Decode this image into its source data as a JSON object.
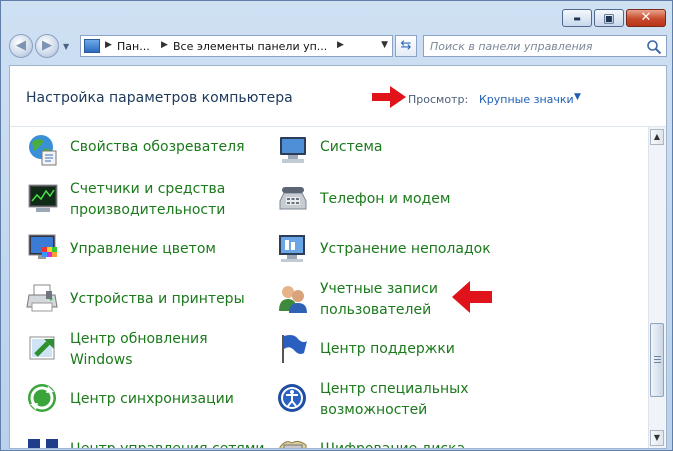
{
  "window": {
    "controls": {
      "minimize": "▬",
      "maximize": "▣",
      "close": "✕"
    }
  },
  "navbar": {
    "back": "◀",
    "forward": "▶",
    "history_drop": "▼",
    "address": {
      "seg1": "Пан...",
      "seg2": "Все элементы панели уп...",
      "sep": "▶",
      "drop": "▼"
    },
    "refresh": "⇆",
    "search_placeholder": "Поиск в панели управления"
  },
  "header": {
    "title": "Настройка параметров компьютера",
    "view_label": "Просмотр:",
    "view_value": "Крупные значки",
    "view_caret": "▼"
  },
  "items": [
    {
      "id": "browser",
      "icon": "globe-icon",
      "label": [
        "Свойства обозревателя"
      ]
    },
    {
      "id": "system",
      "icon": "computer-icon",
      "label": [
        "Система"
      ]
    },
    {
      "id": "perf",
      "icon": "performance-monitor-icon",
      "label": [
        "Счетчики и средства",
        "производительности"
      ]
    },
    {
      "id": "phone",
      "icon": "telephone-icon",
      "label": [
        "Телефон и модем"
      ]
    },
    {
      "id": "color",
      "icon": "color-management-icon",
      "label": [
        "Управление цветом"
      ]
    },
    {
      "id": "troubleshoot",
      "icon": "troubleshooting-icon",
      "label": [
        "Устранение неполадок"
      ]
    },
    {
      "id": "devices",
      "icon": "printer-icon",
      "label": [
        "Устройства и принтеры"
      ]
    },
    {
      "id": "accounts",
      "icon": "user-accounts-icon",
      "label": [
        "Учетные записи",
        "пользователей"
      ]
    },
    {
      "id": "update",
      "icon": "windows-update-icon",
      "label": [
        "Центр обновления",
        "Windows"
      ]
    },
    {
      "id": "support",
      "icon": "flag-icon",
      "label": [
        "Центр поддержки"
      ]
    },
    {
      "id": "sync",
      "icon": "sync-icon",
      "label": [
        "Центр синхронизации"
      ]
    },
    {
      "id": "access",
      "icon": "accessibility-icon",
      "label": [
        "Центр специальных",
        "возможностей"
      ]
    },
    {
      "id": "network",
      "icon": "network-icon",
      "label": [
        "Центр управления сетями"
      ]
    },
    {
      "id": "encrypt",
      "icon": "disk-encryption-icon",
      "label": [
        "Шифрование диска"
      ]
    }
  ],
  "colors": {
    "link_green": "#1b7a1b",
    "title_blue": "#1e395b",
    "annotation_red": "#e0131b"
  },
  "scrollbar": {
    "up": "▲",
    "down": "▼"
  }
}
